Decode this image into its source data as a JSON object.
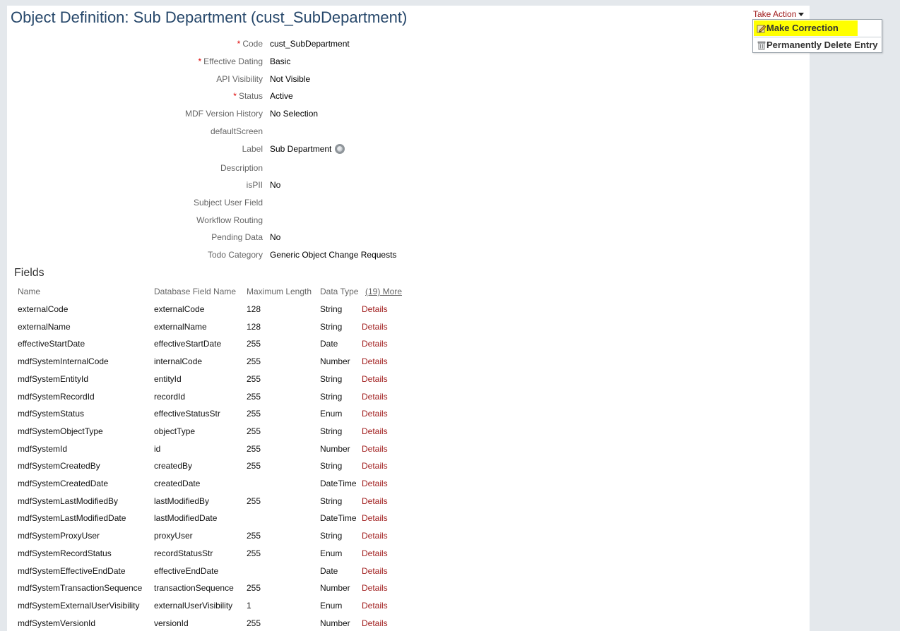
{
  "page_title": "Object Definition: Sub Department (cust_SubDepartment)",
  "take_action": {
    "label": "Take Action",
    "menu": [
      {
        "label": "Make Correction",
        "icon": "pencil-icon",
        "highlighted": true
      },
      {
        "label": "Permanently Delete Entry",
        "icon": "trash-icon"
      }
    ]
  },
  "form": [
    {
      "label": "Code",
      "required": true,
      "value": "cust_SubDepartment"
    },
    {
      "label": "Effective Dating",
      "required": true,
      "value": "Basic"
    },
    {
      "label": "API Visibility",
      "required": false,
      "value": "Not Visible"
    },
    {
      "label": "Status",
      "required": true,
      "value": "Active"
    },
    {
      "label": "MDF Version History",
      "required": false,
      "value": "No Selection"
    },
    {
      "label": "defaultScreen",
      "required": false,
      "value": ""
    },
    {
      "label": "Label",
      "required": false,
      "value": "Sub Department",
      "icon": "globe-icon"
    },
    {
      "label": "Description",
      "required": false,
      "value": ""
    },
    {
      "label": "isPII",
      "required": false,
      "value": "No"
    },
    {
      "label": "Subject User Field",
      "required": false,
      "value": ""
    },
    {
      "label": "Workflow Routing",
      "required": false,
      "value": ""
    },
    {
      "label": "Pending Data",
      "required": false,
      "value": "No"
    },
    {
      "label": "Todo Category",
      "required": false,
      "value": "Generic Object Change Requests"
    }
  ],
  "fields_section": {
    "title": "Fields",
    "columns": [
      "Name",
      "Database Field Name",
      "Maximum Length",
      "Data Type"
    ],
    "more_link": "(19) More",
    "details_label": "Details",
    "rows": [
      {
        "name": "externalCode",
        "db": "externalCode",
        "max": "128",
        "type": "String"
      },
      {
        "name": "externalName",
        "db": "externalName",
        "max": "128",
        "type": "String"
      },
      {
        "name": "effectiveStartDate",
        "db": "effectiveStartDate",
        "max": "255",
        "type": "Date"
      },
      {
        "name": "mdfSystemInternalCode",
        "db": "internalCode",
        "max": "255",
        "type": "Number"
      },
      {
        "name": "mdfSystemEntityId",
        "db": "entityId",
        "max": "255",
        "type": "String"
      },
      {
        "name": "mdfSystemRecordId",
        "db": "recordId",
        "max": "255",
        "type": "String"
      },
      {
        "name": "mdfSystemStatus",
        "db": "effectiveStatusStr",
        "max": "255",
        "type": "Enum"
      },
      {
        "name": "mdfSystemObjectType",
        "db": "objectType",
        "max": "255",
        "type": "String"
      },
      {
        "name": "mdfSystemId",
        "db": "id",
        "max": "255",
        "type": "Number"
      },
      {
        "name": "mdfSystemCreatedBy",
        "db": "createdBy",
        "max": "255",
        "type": "String"
      },
      {
        "name": "mdfSystemCreatedDate",
        "db": "createdDate",
        "max": "",
        "type": "DateTime"
      },
      {
        "name": "mdfSystemLastModifiedBy",
        "db": "lastModifiedBy",
        "max": "255",
        "type": "String"
      },
      {
        "name": "mdfSystemLastModifiedDate",
        "db": "lastModifiedDate",
        "max": "",
        "type": "DateTime"
      },
      {
        "name": "mdfSystemProxyUser",
        "db": "proxyUser",
        "max": "255",
        "type": "String"
      },
      {
        "name": "mdfSystemRecordStatus",
        "db": "recordStatusStr",
        "max": "255",
        "type": "Enum"
      },
      {
        "name": "mdfSystemEffectiveEndDate",
        "db": "effectiveEndDate",
        "max": "",
        "type": "Date"
      },
      {
        "name": "mdfSystemTransactionSequence",
        "db": "transactionSequence",
        "max": "255",
        "type": "Number"
      },
      {
        "name": "mdfSystemExternalUserVisibility",
        "db": "externalUserVisibility",
        "max": "1",
        "type": "Enum"
      },
      {
        "name": "mdfSystemVersionId",
        "db": "versionId",
        "max": "255",
        "type": "Number"
      }
    ]
  }
}
